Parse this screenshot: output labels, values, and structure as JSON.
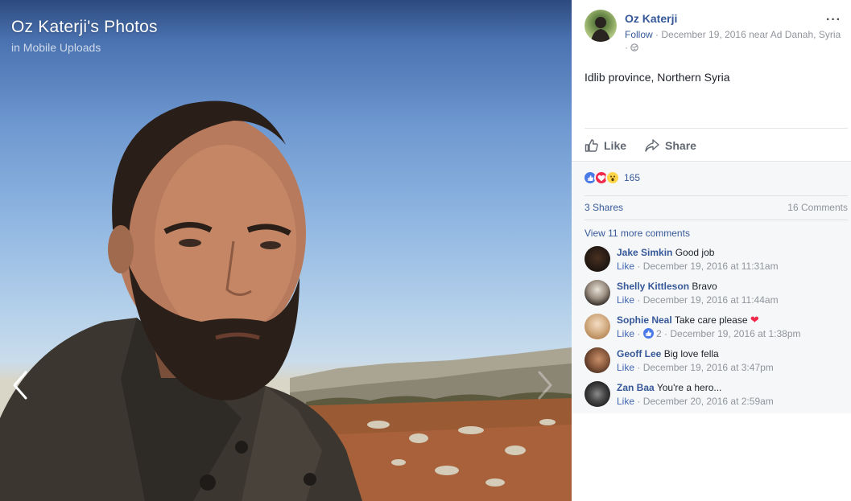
{
  "stage": {
    "title": "Oz Katerji's Photos",
    "subtitle": "in Mobile Uploads"
  },
  "post": {
    "author": "Oz Katerji",
    "follow": "Follow",
    "meta_sep": " · ",
    "date_location": "December 19, 2016 near Ad Danah, Syria",
    "meta_tail": "· ",
    "caption": "Idlib province, Northern Syria",
    "more": "···"
  },
  "actions": {
    "like": "Like",
    "share": "Share"
  },
  "feedback": {
    "reaction_count": "165",
    "reactions": [
      "like",
      "love",
      "wow"
    ],
    "shares": "3 Shares",
    "comments": "16 Comments",
    "view_more": "View 11 more comments"
  },
  "comments": [
    {
      "name": "Jake Simkin",
      "text": "Good job",
      "like": "Like",
      "sep": " · ",
      "time": "December 19, 2016 at 11:31am",
      "reaction_count": ""
    },
    {
      "name": "Shelly Kittleson",
      "text": "Bravo",
      "like": "Like",
      "sep": " · ",
      "time": "December 19, 2016 at 11:44am",
      "reaction_count": ""
    },
    {
      "name": "Sophie Neal",
      "text": "Take care please",
      "like": "Like",
      "sep": " · ",
      "time": "December 19, 2016 at 1:38pm",
      "reaction_count": "2"
    },
    {
      "name": "Geoff Lee",
      "text": "Big love fella",
      "like": "Like",
      "sep": " · ",
      "time": "December 19, 2016 at 3:47pm",
      "reaction_count": ""
    },
    {
      "name": "Zan Baa",
      "text": "You're a hero...",
      "like": "Like",
      "sep": " · ",
      "time": "December 20, 2016 at 2:59am",
      "reaction_count": ""
    }
  ],
  "colors": {
    "link_blue": "#365899",
    "like_blue": "#4267b2",
    "meta_gray": "#90949c",
    "feedback_bg": "#f6f7f9"
  },
  "icons": {
    "prev": "chevron-left-icon",
    "next": "chevron-right-icon",
    "like": "thumbs-up-icon",
    "share": "share-arrow-icon",
    "more": "more-options-icon"
  }
}
